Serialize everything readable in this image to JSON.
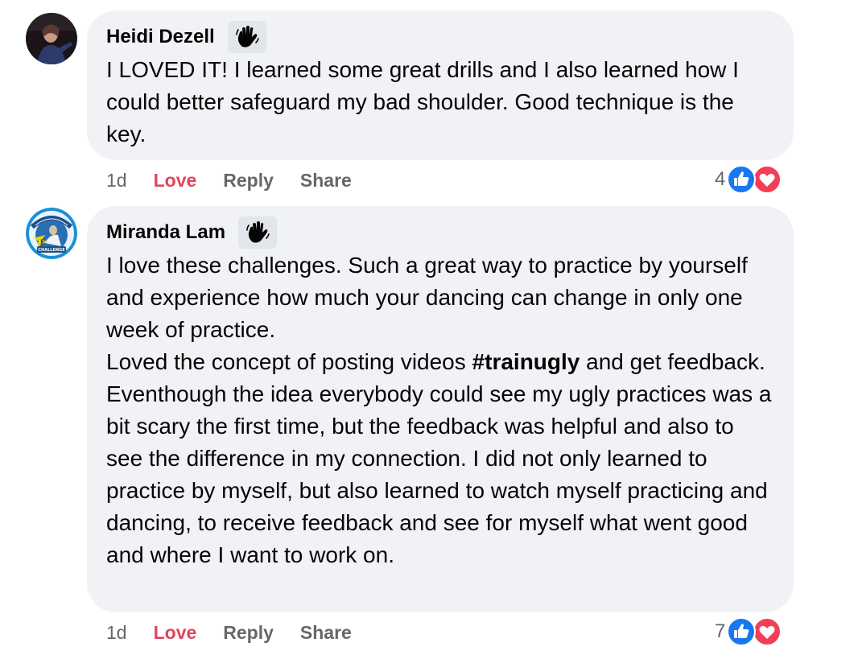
{
  "comments": [
    {
      "author": "Heidi Dezell",
      "badge_icon": "waving-hand-icon",
      "text_lines": [
        "I LOVED IT! I learned some great drills and I also learned how I could better safeguard my bad shoulder. Good technique is the key."
      ],
      "time": "1d",
      "love_label": "Love",
      "reply_label": "Reply",
      "share_label": "Share",
      "reaction_count": "4",
      "reactions": [
        "like-icon",
        "heart-icon"
      ]
    },
    {
      "author": "Miranda Lam",
      "badge_icon": "waving-hand-icon",
      "avatar_text": [
        "ARE YOU UP FOR A CHALLENGE?",
        "E",
        "CHALLENGE"
      ],
      "text_para1": "I love these challenges. Such a great way to practice by yourself and experience how much your dancing can change in only one week of practice.",
      "text_para2_before": "Loved the concept of posting videos ",
      "text_para2_hashtag": "#trainugly",
      "text_para2_after": " and get feedback. Eventhough the idea everybody could see my ugly practices was a bit scary the first time, but the feedback was helpful and also to see the difference in my connection. I did not only learned to practice by myself, but also learned to watch myself practicing and dancing, to receive feedback and see for myself what went good and where I want to work on.",
      "time": "1d",
      "love_label": "Love",
      "reply_label": "Reply",
      "share_label": "Share",
      "reaction_count": "7",
      "reactions": [
        "like-icon",
        "heart-icon"
      ]
    }
  ],
  "colors": {
    "bubble_bg": "#f0f2f5",
    "love_red": "#e0475a",
    "like_blue": "#1877f2",
    "heart_red": "#f33e58",
    "muted": "#65676b"
  }
}
